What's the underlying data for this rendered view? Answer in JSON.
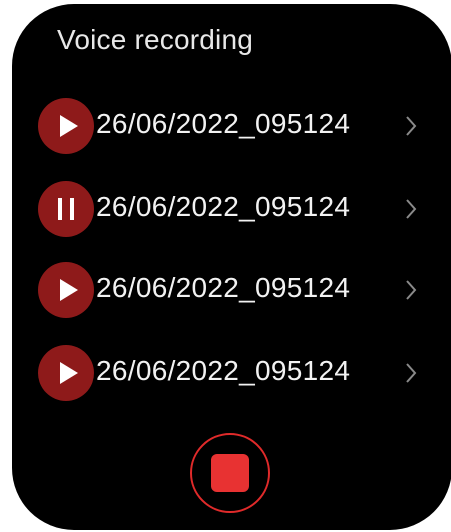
{
  "header": {
    "title": "Voice recording"
  },
  "recordings": [
    {
      "name": "26/06/2022_095124",
      "state": "play",
      "icon": "play-icon"
    },
    {
      "name": "26/06/2022_095124",
      "state": "pause",
      "icon": "pause-icon"
    },
    {
      "name": "26/06/2022_095124",
      "state": "play",
      "icon": "play-icon"
    },
    {
      "name": "26/06/2022_095124",
      "state": "play",
      "icon": "play-icon"
    }
  ],
  "record_control": {
    "icon": "stop-icon"
  },
  "colors": {
    "background": "#000000",
    "play_button": "#8e1a1a",
    "record_ring": "#e02a2a",
    "stop_square": "#e83232"
  }
}
